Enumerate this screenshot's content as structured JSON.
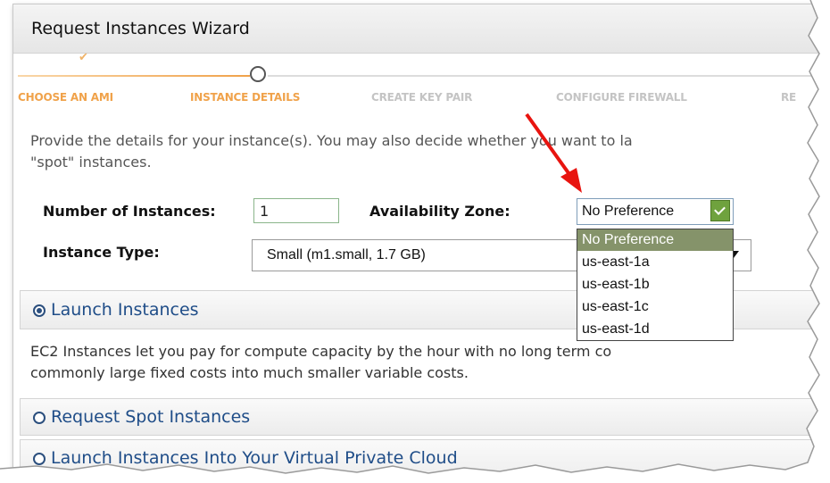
{
  "wizard": {
    "title": "Request Instances Wizard",
    "steps": [
      {
        "label": "CHOOSE AN AMI",
        "state": "complete"
      },
      {
        "label": "INSTANCE DETAILS",
        "state": "current"
      },
      {
        "label": "CREATE KEY PAIR",
        "state": "pending"
      },
      {
        "label": "CONFIGURE FIREWALL",
        "state": "pending"
      },
      {
        "label": "RE",
        "state": "pending"
      }
    ]
  },
  "intro": {
    "line1": "Provide the details for your instance(s). You may also decide whether you want to la",
    "line2": "\"spot\" instances."
  },
  "form": {
    "num_instances_label": "Number of Instances:",
    "num_instances_value": "1",
    "az_label": "Availability Zone:",
    "az_selected": "No Preference",
    "az_options": [
      "No Preference",
      "us-east-1a",
      "us-east-1b",
      "us-east-1c",
      "us-east-1d"
    ],
    "instance_type_label": "Instance Type:",
    "instance_type_value": "Small (m1.small, 1.7 GB)"
  },
  "sections": {
    "launch": {
      "title": "Launch Instances",
      "selected": true,
      "body_line1": "EC2 Instances let you pay for compute capacity by the hour with no long term co",
      "body_line2": "commonly large fixed costs into much smaller variable costs."
    },
    "spot": {
      "title": "Request Spot Instances",
      "selected": false
    },
    "vpc": {
      "title": "Launch Instances Into Your Virtual Private Cloud",
      "selected": false
    }
  },
  "colors": {
    "accent_orange": "#f0a24a",
    "section_title_blue": "#1f4d88",
    "dropdown_selected": "#85936a",
    "arrow_red": "#e8140f"
  }
}
